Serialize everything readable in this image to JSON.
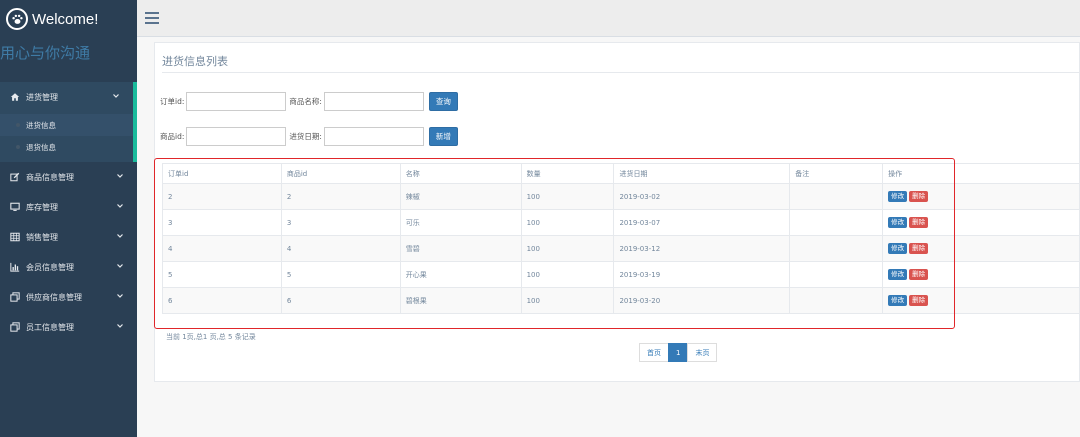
{
  "brand": {
    "title": "Welcome!",
    "motto": "用心与你沟通",
    "logo_icon": "paw-icon"
  },
  "sidebar": {
    "items": [
      {
        "label": "进货管理",
        "icon": "home-icon",
        "expanded": true,
        "children": [
          {
            "label": "进货信息",
            "current": true
          },
          {
            "label": "退货信息",
            "current": false
          }
        ]
      },
      {
        "label": "商品信息管理",
        "icon": "edit-icon"
      },
      {
        "label": "库存管理",
        "icon": "desktop-icon"
      },
      {
        "label": "销售管理",
        "icon": "table-icon"
      },
      {
        "label": "会员信息管理",
        "icon": "bar-chart-icon"
      },
      {
        "label": "供应商信息管理",
        "icon": "clone-icon"
      },
      {
        "label": "员工信息管理",
        "icon": "clone-icon"
      }
    ]
  },
  "topbar": {
    "menu_icon": "hamburger-icon"
  },
  "panel": {
    "title": "进货信息列表",
    "form": {
      "order_id_label": "订单id:",
      "order_id_value": "",
      "product_name_label": "商品名称:",
      "product_name_value": "",
      "query_button": "查询",
      "product_id_label": "商品id:",
      "product_id_value": "",
      "purchase_date_label": "进货日期:",
      "purchase_date_value": "",
      "add_button": "新增"
    },
    "table": {
      "headers": [
        "订单id",
        "商品id",
        "名称",
        "数量",
        "进货日期",
        "备注",
        "操作"
      ],
      "rows": [
        [
          "2",
          "2",
          "辣椒",
          "100",
          "2019-03-02",
          ""
        ],
        [
          "3",
          "3",
          "可乐",
          "100",
          "2019-03-07",
          ""
        ],
        [
          "4",
          "4",
          "雪碧",
          "100",
          "2019-03-12",
          ""
        ],
        [
          "5",
          "5",
          "开心果",
          "100",
          "2019-03-19",
          ""
        ],
        [
          "6",
          "6",
          "碧根果",
          "100",
          "2019-03-20",
          ""
        ]
      ],
      "edit_label": "修改",
      "delete_label": "删除"
    },
    "page_info": "当前 1页,总1 页,总 5 条记录",
    "pager": {
      "first": "首页",
      "current": "1",
      "last": "末页"
    }
  },
  "colors": {
    "sidebar_bg": "#2a3f54",
    "primary": "#337ab7",
    "danger": "#d9534f",
    "highlight_box": "#e0262a",
    "active_bar": "#1abb9c"
  }
}
